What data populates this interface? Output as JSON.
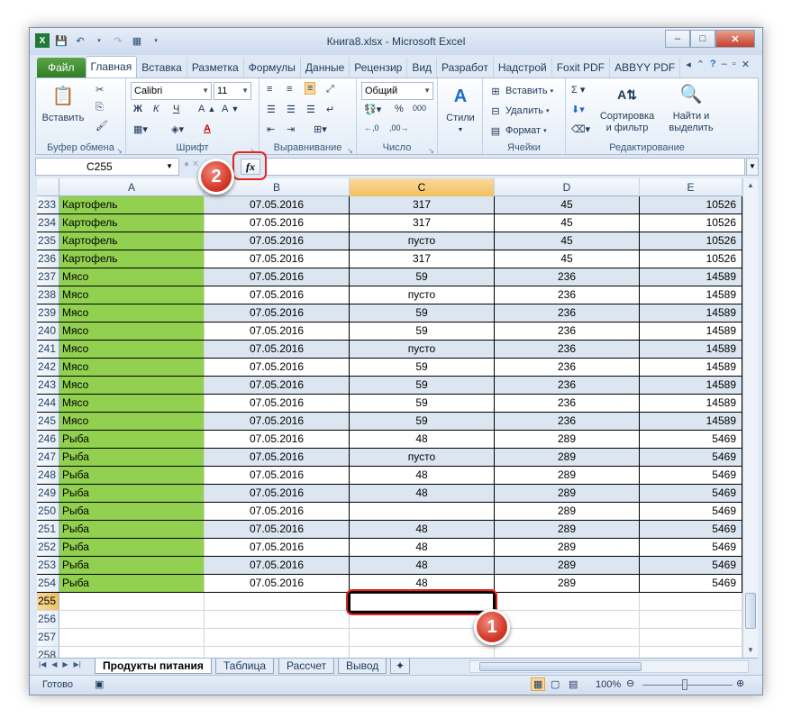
{
  "window": {
    "title": "Книга8.xlsx - Microsoft Excel",
    "controls": {
      "minimize": "–",
      "maximize": "□",
      "close": "✕"
    }
  },
  "ribbon_tabs": [
    "Файл",
    "Главная",
    "Вставка",
    "Разметка",
    "Формулы",
    "Данные",
    "Рецензир",
    "Вид",
    "Разработ",
    "Надстрой",
    "Foxit PDF",
    "ABBYY PDF"
  ],
  "ribbon": {
    "clipboard": {
      "label": "Буфер обмена",
      "paste": "Вставить"
    },
    "font": {
      "label": "Шрифт",
      "name": "Calibri",
      "size": "11",
      "bold": "Ж",
      "italic": "К",
      "underline": "Ч",
      "font_color": "А"
    },
    "alignment": {
      "label": "Выравнивание"
    },
    "number": {
      "label": "Число",
      "format": "Общий",
      "percent": "%",
      "thousands": "000"
    },
    "styles": {
      "label": "Стили"
    },
    "cells": {
      "label": "Ячейки",
      "insert": "Вставить",
      "delete": "Удалить",
      "format": "Формат"
    },
    "editing": {
      "label": "Редактирование",
      "sort_line1": "Сортировка",
      "sort_line2": "и фильтр",
      "find_line1": "Найти и",
      "find_line2": "выделить"
    }
  },
  "formula_bar": {
    "name_box": "C255",
    "fx": "fx",
    "formula": ""
  },
  "columns": [
    "A",
    "B",
    "C",
    "D",
    "E"
  ],
  "selected_column": "C",
  "selected_row": "255",
  "rows": [
    {
      "n": "233",
      "a": "Картофель",
      "b": "07.05.2016",
      "c": "317",
      "d": "45",
      "e": "10526"
    },
    {
      "n": "234",
      "a": "Картофель",
      "b": "07.05.2016",
      "c": "317",
      "d": "45",
      "e": "10526"
    },
    {
      "n": "235",
      "a": "Картофель",
      "b": "07.05.2016",
      "c": "пусто",
      "d": "45",
      "e": "10526"
    },
    {
      "n": "236",
      "a": "Картофель",
      "b": "07.05.2016",
      "c": "317",
      "d": "45",
      "e": "10526"
    },
    {
      "n": "237",
      "a": "Мясо",
      "b": "07.05.2016",
      "c": "59",
      "d": "236",
      "e": "14589"
    },
    {
      "n": "238",
      "a": "Мясо",
      "b": "07.05.2016",
      "c": "пусто",
      "d": "236",
      "e": "14589"
    },
    {
      "n": "239",
      "a": "Мясо",
      "b": "07.05.2016",
      "c": "59",
      "d": "236",
      "e": "14589"
    },
    {
      "n": "240",
      "a": "Мясо",
      "b": "07.05.2016",
      "c": "59",
      "d": "236",
      "e": "14589"
    },
    {
      "n": "241",
      "a": "Мясо",
      "b": "07.05.2016",
      "c": "пусто",
      "d": "236",
      "e": "14589"
    },
    {
      "n": "242",
      "a": "Мясо",
      "b": "07.05.2016",
      "c": "59",
      "d": "236",
      "e": "14589"
    },
    {
      "n": "243",
      "a": "Мясо",
      "b": "07.05.2016",
      "c": "59",
      "d": "236",
      "e": "14589"
    },
    {
      "n": "244",
      "a": "Мясо",
      "b": "07.05.2016",
      "c": "59",
      "d": "236",
      "e": "14589"
    },
    {
      "n": "245",
      "a": "Мясо",
      "b": "07.05.2016",
      "c": "59",
      "d": "236",
      "e": "14589"
    },
    {
      "n": "246",
      "a": "Рыба",
      "b": "07.05.2016",
      "c": "48",
      "d": "289",
      "e": "5469"
    },
    {
      "n": "247",
      "a": "Рыба",
      "b": "07.05.2016",
      "c": "пусто",
      "d": "289",
      "e": "5469"
    },
    {
      "n": "248",
      "a": "Рыба",
      "b": "07.05.2016",
      "c": "48",
      "d": "289",
      "e": "5469"
    },
    {
      "n": "249",
      "a": "Рыба",
      "b": "07.05.2016",
      "c": "48",
      "d": "289",
      "e": "5469"
    },
    {
      "n": "250",
      "a": "Рыба",
      "b": "07.05.2016",
      "c": "",
      "d": "289",
      "e": "5469"
    },
    {
      "n": "251",
      "a": "Рыба",
      "b": "07.05.2016",
      "c": "48",
      "d": "289",
      "e": "5469"
    },
    {
      "n": "252",
      "a": "Рыба",
      "b": "07.05.2016",
      "c": "48",
      "d": "289",
      "e": "5469"
    },
    {
      "n": "253",
      "a": "Рыба",
      "b": "07.05.2016",
      "c": "48",
      "d": "289",
      "e": "5469"
    },
    {
      "n": "254",
      "a": "Рыба",
      "b": "07.05.2016",
      "c": "48",
      "d": "289",
      "e": "5469"
    }
  ],
  "empty_rows": [
    "255",
    "256",
    "257",
    "258"
  ],
  "sheets": [
    "Продукты питания",
    "Таблица",
    "Рассчет",
    "Вывод"
  ],
  "active_sheet": "Продукты питания",
  "status": {
    "ready": "Готово",
    "zoom": "100%"
  },
  "callouts": {
    "one": "1",
    "two": "2"
  },
  "colors": {
    "name_fill": "#92d050",
    "band_fill": "#dce6f1",
    "callout": "#e8211d",
    "file_tab": "#2f7d24"
  }
}
